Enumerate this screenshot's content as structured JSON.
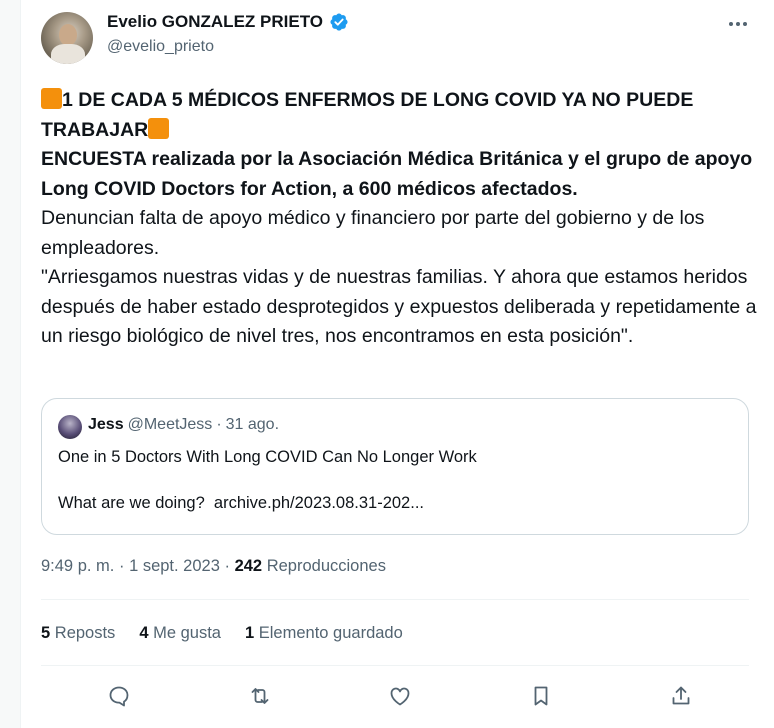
{
  "author": {
    "display_name": "Evelio GONZALEZ PRIETO",
    "handle": "@evelio_prieto",
    "verified": true
  },
  "post": {
    "headline_1": "1 DE CADA 5 MÉDICOS ENFERMOS DE LONG COVID YA NO PUEDE TRABAJAR",
    "bold_line": "ENCUESTA realizada por la Asociación Médica Británica y el grupo de apoyo Long COVID Doctors for Action, a 600 médicos afectados.",
    "line_2": "Denuncian falta de apoyo médico y financiero por parte del gobierno y de los empleadores.",
    "line_3": "\"Arriesgamos nuestras vidas y de nuestras familias. Y ahora que estamos heridos después de haber estado desprotegidos y expuestos deliberada y repetidamente a un riesgo biológico de nivel tres, nos encontramos en esta posición\"."
  },
  "quote": {
    "name": "Jess",
    "handle": "@MeetJess",
    "sep": "·",
    "date": "31 ago.",
    "text": "One in 5 Doctors With Long COVID Can No Longer Work\n\nWhat are we doing?  archive.ph/2023.08.31-202..."
  },
  "meta": {
    "time": "9:49 p. m.",
    "sep": "·",
    "date": "1 sept. 2023",
    "views": "242",
    "views_label": "Reproducciones"
  },
  "stats": {
    "reposts": "5",
    "reposts_label": "Reposts",
    "likes": "4",
    "likes_label": "Me gusta",
    "saved": "1",
    "saved_label": "Elemento guardado"
  },
  "colors": {
    "accent": "#1d9bf0",
    "secondary_text": "#536471",
    "emoji_square": "#f4900c"
  },
  "icons": [
    "verified-icon",
    "more-icon",
    "reply-icon",
    "repost-icon",
    "like-icon",
    "bookmark-icon",
    "share-icon"
  ]
}
